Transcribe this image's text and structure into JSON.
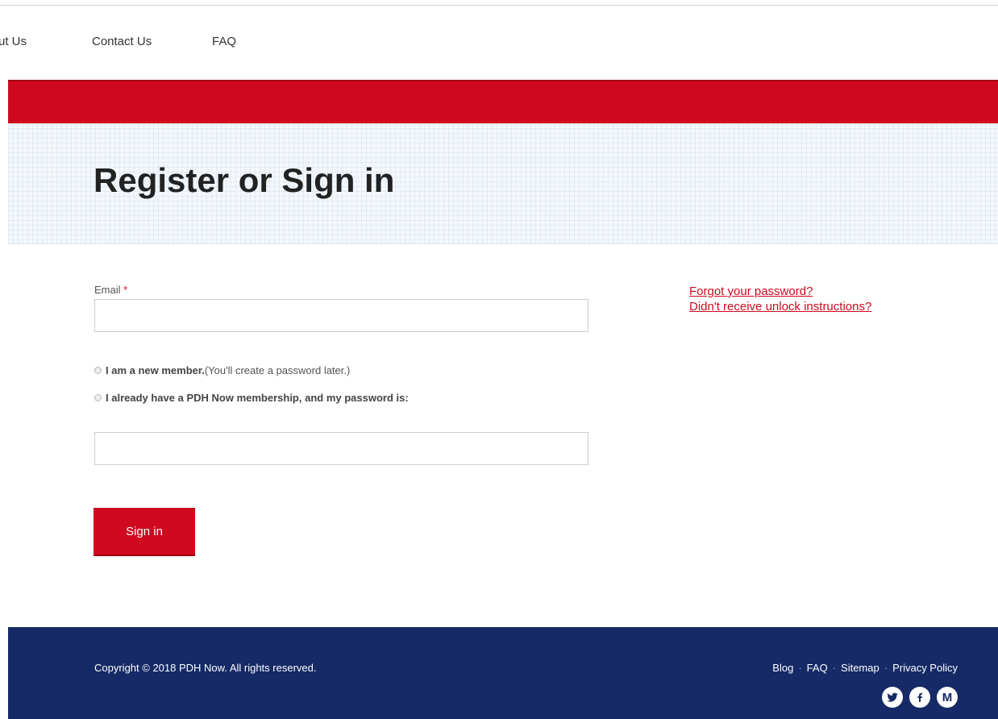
{
  "nav": {
    "items": [
      "ut Us",
      "Contact Us",
      "FAQ"
    ]
  },
  "hero": {
    "title": "Register or Sign in"
  },
  "form": {
    "email_label": "Email",
    "required_marker": "*",
    "email_value": "",
    "option_new_bold": "I am a new member.",
    "option_new_note": " (You'll create a password later.)",
    "option_existing": "I already have a PDH Now membership, and my password is:",
    "password_value": "",
    "submit_label": "Sign in"
  },
  "side_links": {
    "forgot_password": "Forgot your password?",
    "unlock": "Didn't receive unlock instructions?"
  },
  "footer": {
    "copyright": "Copyright © 2018 PDH Now. All rights reserved.",
    "links": [
      "Blog",
      "FAQ",
      "Sitemap",
      "Privacy Policy"
    ],
    "separator": "·",
    "social_icons": [
      "twitter-icon",
      "facebook-icon",
      "medium-icon"
    ],
    "medium_letter": "M"
  },
  "colors": {
    "brand_red": "#cf0a1e",
    "footer_navy": "#152a66"
  }
}
